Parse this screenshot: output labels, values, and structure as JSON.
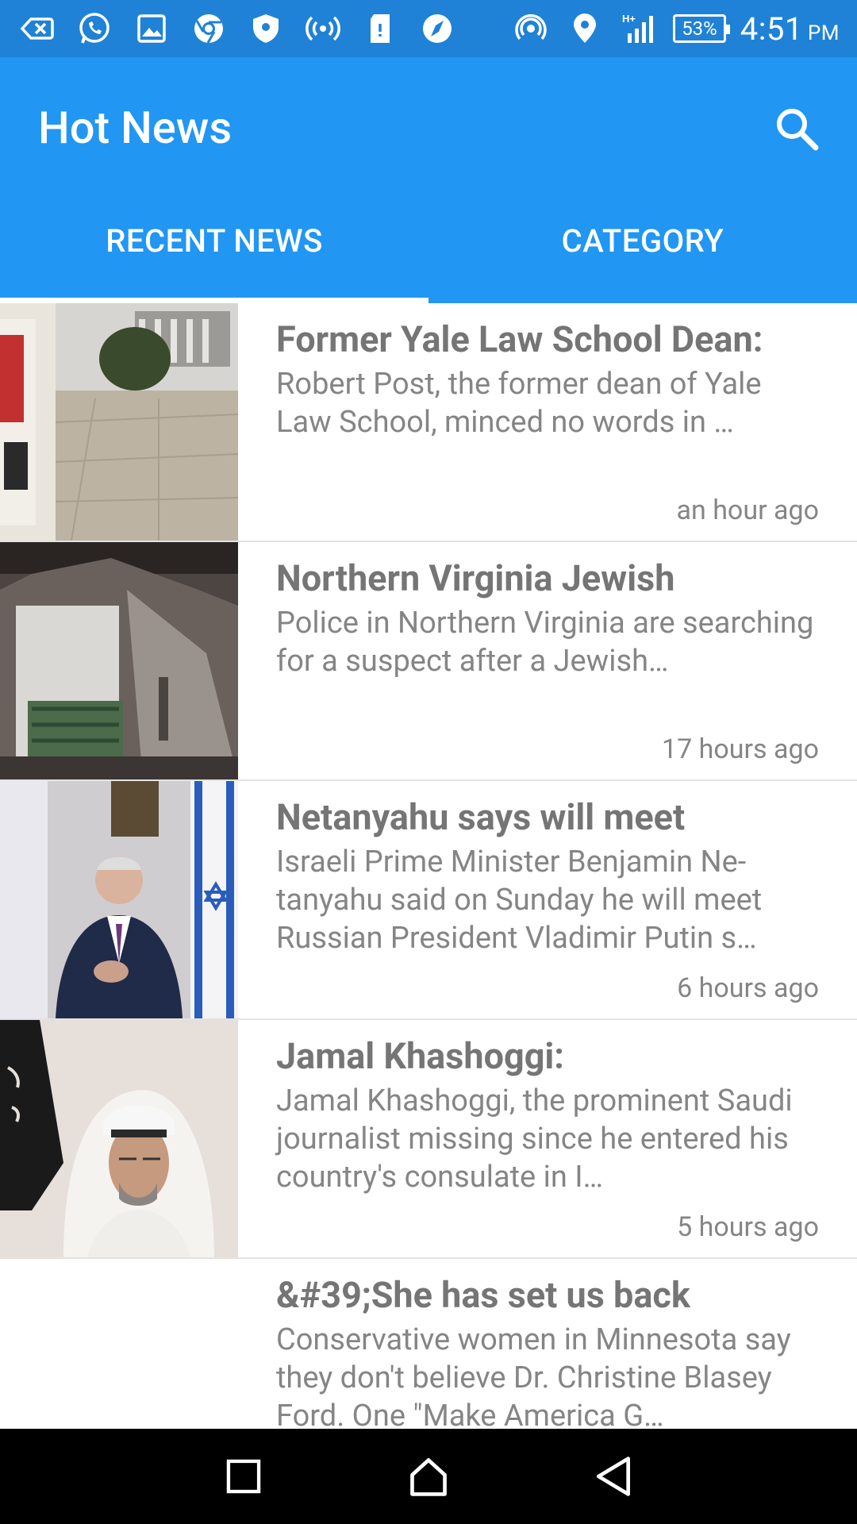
{
  "status_bar": {
    "battery_percent": "53%",
    "time": "4:51",
    "ampm": "PM",
    "left_icons": [
      "back-arrow-icon",
      "whatsapp-icon",
      "gallery-icon",
      "chrome-icon",
      "shield-icon",
      "hotspot-icon",
      "sd-card-alert-icon",
      "compass-icon"
    ],
    "right_icons": [
      "cast-icon",
      "location-icon",
      "signal-icon",
      "battery-icon"
    ]
  },
  "app_bar": {
    "title": "Hot News",
    "color": "#2196f3",
    "search_icon": "search-icon"
  },
  "tabs": [
    {
      "label": "RECENT NEWS",
      "selected": true
    },
    {
      "label": "CATEGORY",
      "selected": false
    }
  ],
  "news": [
    {
      "title": "Former Yale Law School Dean:",
      "description": "Robert Post, the former dean of Yale Law School, minced no words in …",
      "time": "an hour ago"
    },
    {
      "title": "Northern Virginia Jewish",
      "description": "Police in Northern Virginia are searching for a suspect after a Jewish…",
      "time": "17 hours ago"
    },
    {
      "title": "Netanyahu says will meet",
      "description": "Israeli Prime Minister Benjamin Ne-tanyahu said on Sunday he will meet Russian President Vladimir Putin s…",
      "time": "6 hours ago"
    },
    {
      "title": "Jamal Khashoggi:",
      "description": "Jamal Khashoggi, the prominent Saudi journalist missing since he entered his country's consulate in I…",
      "time": "5 hours ago"
    },
    {
      "title": "&#39;She has set us back",
      "description": "Conservative women in Minnesota say they don't believe Dr. Christine Blasey Ford. One \"Make America G…",
      "time": ""
    }
  ],
  "nav_bar": [
    "recents-square-icon",
    "home-icon",
    "back-triangle-icon"
  ]
}
